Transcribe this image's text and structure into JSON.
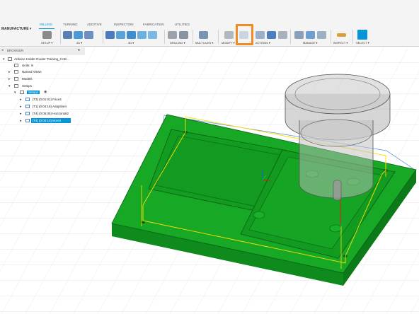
{
  "toolbar": {
    "workspace": "MANUFACTURE",
    "tabs": [
      "MILLING",
      "TURNING",
      "ADDITIVE",
      "INSPECTION",
      "FABRICATION",
      "UTILITIES"
    ],
    "active_tab": "MILLING",
    "groups": {
      "setup": "SETUP",
      "two_d": "2D",
      "three_d": "3D",
      "drilling": "DRILLING",
      "multi_axis": "MULTI-AXIS",
      "modify": "MODIFY",
      "actions": "ACTIONS",
      "manage": "MANAGE",
      "inspect": "INSPECT",
      "select": "SELECT"
    },
    "highlighted_tool": "simulate-icon",
    "accent_color": "#0696d7",
    "highlight_color": "#f08a24"
  },
  "browser": {
    "title": "BROWSER",
    "document": "Arduino Holder Router Training_CAD...",
    "units": "Units: in",
    "named_views": "Named Views",
    "models": "Models",
    "setups": "Setups",
    "setup": "Setup1",
    "operations": [
      "[T3] (0:01:01) Face4",
      "[T1] (0:04:16) Adaptive4",
      "[T4] (0:05:05) Horizontal2",
      "[T4] (0:00:10) Bore2"
    ],
    "selected_operation": "[T4] (0:00:10) Bore2"
  },
  "model": {
    "body_color": "#17a826",
    "edge_color": "#0a5c12"
  }
}
